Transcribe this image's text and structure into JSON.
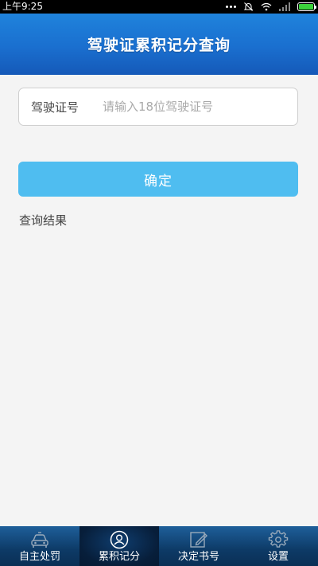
{
  "status_bar": {
    "time": "上午9:25"
  },
  "header": {
    "title": "驾驶证累积记分查询"
  },
  "form": {
    "license_label": "驾驶证号",
    "license_placeholder": "请输入18位驾驶证号",
    "license_value": "",
    "confirm_label": "确定",
    "result_label": "查询结果"
  },
  "tabs": [
    {
      "label": "自主处罚",
      "icon": "car-icon",
      "active": false
    },
    {
      "label": "累积记分",
      "icon": "user-icon",
      "active": true
    },
    {
      "label": "决定书号",
      "icon": "edit-icon",
      "active": false
    },
    {
      "label": "设置",
      "icon": "gear-icon",
      "active": false
    }
  ],
  "colors": {
    "header_blue": "#1a6fcf",
    "button_blue": "#4fbdf0",
    "tabbar_blue": "#0d3a66",
    "battery_green": "#3bd33b"
  }
}
